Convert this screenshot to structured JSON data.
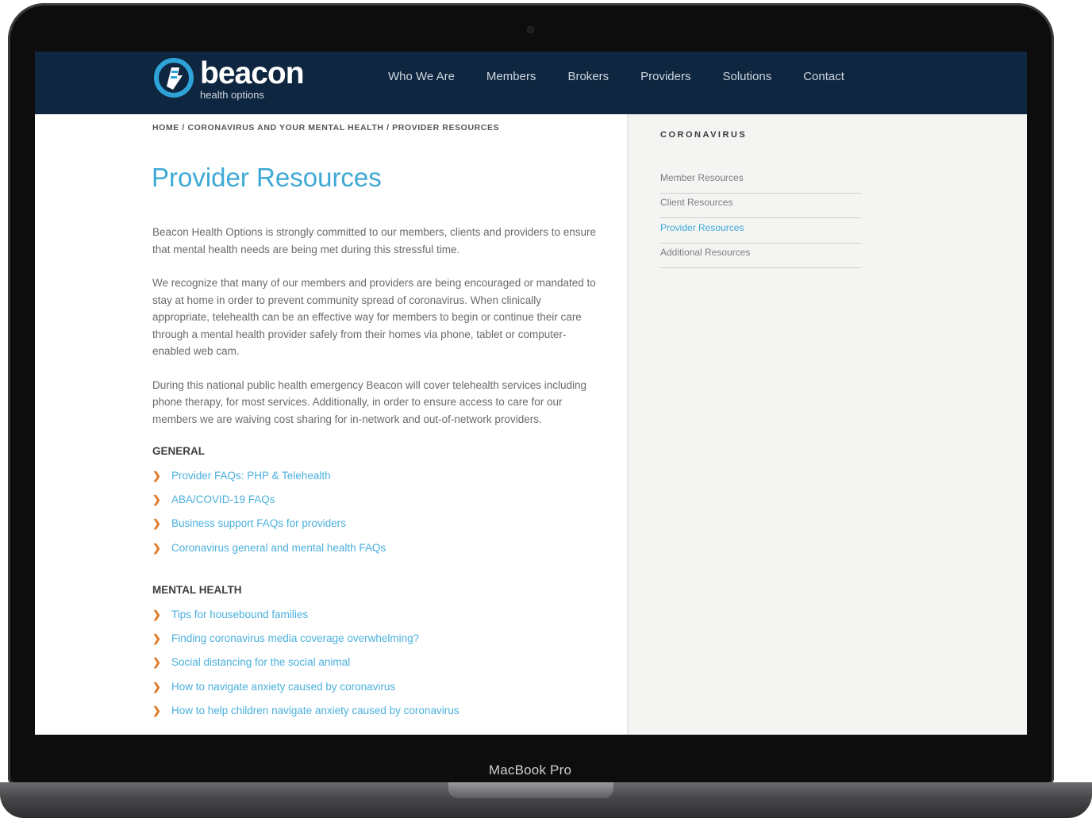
{
  "device": {
    "label": "MacBook Pro"
  },
  "header": {
    "logo": {
      "word": "beacon",
      "sub": "health options"
    },
    "nav": [
      "Who We Are",
      "Members",
      "Brokers",
      "Providers",
      "Solutions",
      "Contact"
    ]
  },
  "breadcrumb": "HOME / CORONAVIRUS AND YOUR MENTAL HEALTH / PROVIDER RESOURCES",
  "page_title": "Provider Resources",
  "paragraphs": [
    "Beacon Health Options is strongly committed to our members, clients and providers to ensure that mental health needs are being met during this stressful time.",
    "We recognize that many of our members and providers are being encouraged or mandated to stay at home in order to prevent community spread of coronavirus.  When clinically appropriate, telehealth can be an effective way for members to begin or continue their care through a mental health provider safely from their homes via phone, tablet or computer-enabled web cam.",
    "During this national public health emergency Beacon will cover telehealth services including phone therapy, for most services. Additionally, in order to ensure access to care for our members we are waiving cost sharing for in-network and out-of-network providers."
  ],
  "sections": [
    {
      "heading": "GENERAL",
      "links": [
        "Provider FAQs: PHP & Telehealth",
        "ABA/COVID-19 FAQs",
        "Business support FAQs for providers",
        "Coronavirus general and mental health FAQs"
      ]
    },
    {
      "heading": "MENTAL HEALTH",
      "links": [
        "Tips for housebound families",
        "Finding coronavirus media coverage overwhelming?",
        "Social distancing for the social animal",
        "How to navigate anxiety caused by coronavirus",
        "How to help children navigate anxiety caused by coronavirus"
      ]
    }
  ],
  "sidebar": {
    "title": "CORONAVIRUS",
    "items": [
      "Member Resources",
      "Client Resources",
      "Provider Resources",
      "Additional Resources"
    ],
    "active_index": 2
  },
  "colors": {
    "header_bg": "#0e2640",
    "accent": "#3fa9d6",
    "chevron": "#e07b2a",
    "sidebar_bg": "#f4f5f3"
  }
}
